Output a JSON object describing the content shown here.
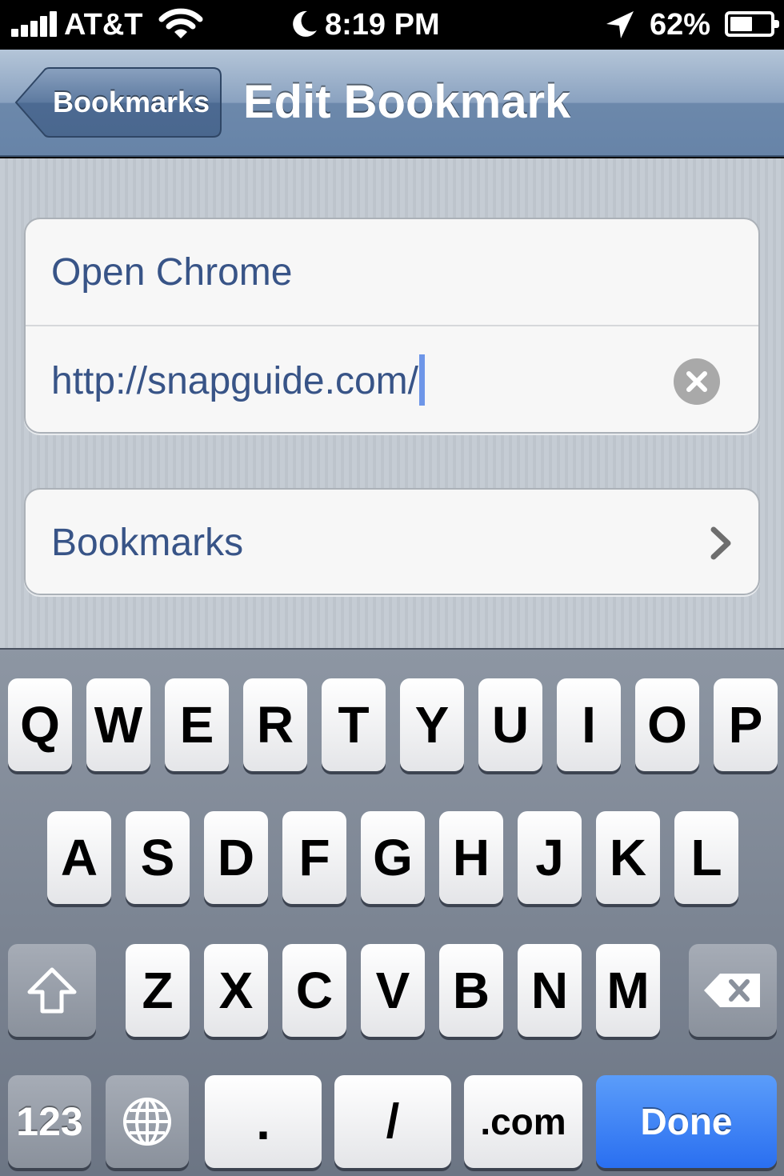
{
  "status_bar": {
    "carrier": "AT&T",
    "time": "8:19 PM",
    "battery_percent": "62%",
    "battery_level": 0.62,
    "icons": [
      "signal-bars-icon",
      "wifi-icon",
      "moon-icon",
      "location-arrow-icon",
      "battery-icon"
    ]
  },
  "nav": {
    "back_label": "Bookmarks",
    "title": "Edit Bookmark"
  },
  "form": {
    "title_value": "Open Chrome",
    "url_value": "http://snapguide.com/",
    "folder_label": "Bookmarks"
  },
  "keyboard": {
    "row1": [
      "Q",
      "W",
      "E",
      "R",
      "T",
      "Y",
      "U",
      "I",
      "O",
      "P"
    ],
    "row2": [
      "A",
      "S",
      "D",
      "F",
      "G",
      "H",
      "J",
      "K",
      "L"
    ],
    "row3": [
      "Z",
      "X",
      "C",
      "V",
      "B",
      "N",
      "M"
    ],
    "numbers_label": "123",
    "period_label": ".",
    "slash_label": "/",
    "dotcom_label": ".com",
    "done_label": "Done"
  },
  "colors": {
    "nav_tint": "#6c88ab",
    "text_blue": "#385487",
    "done_blue": "#2a6ff0"
  }
}
